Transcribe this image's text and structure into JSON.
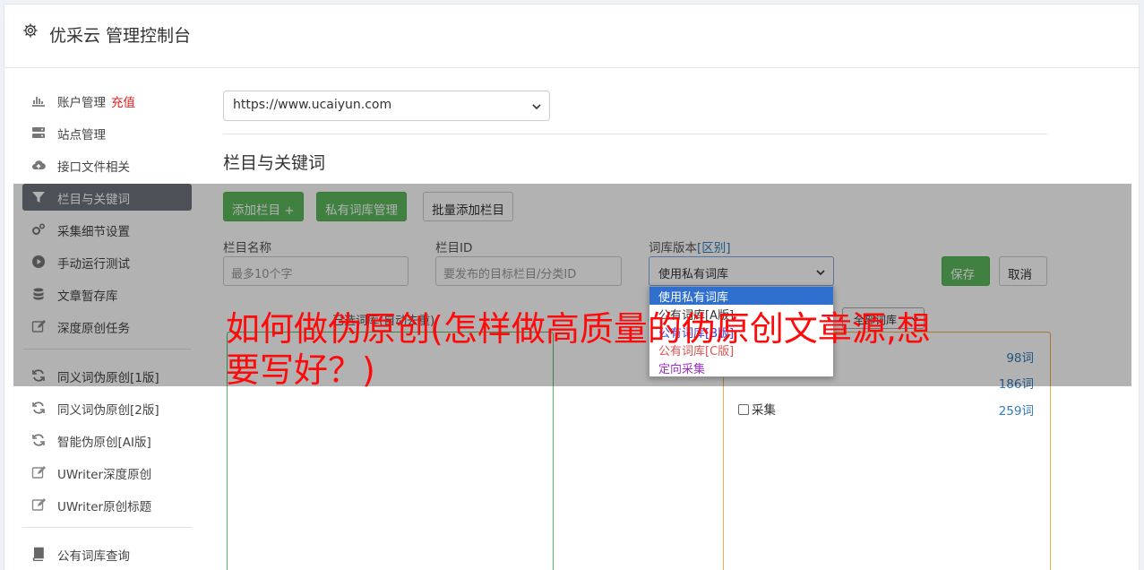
{
  "header": {
    "title": "优采云 管理控制台",
    "icon": "gear-icon"
  },
  "sidebar": {
    "items": [
      {
        "label": "账户管理",
        "extra": "充值",
        "icon": "bar-chart-icon"
      },
      {
        "label": "站点管理",
        "icon": "server-icon"
      },
      {
        "label": "接口文件相关",
        "icon": "cloud-upload-icon"
      },
      {
        "label": "栏目与关键词",
        "icon": "filter-icon",
        "active": true
      },
      {
        "label": "采集细节设置",
        "icon": "cogs-icon"
      },
      {
        "label": "手动运行测试",
        "icon": "play-circle-icon"
      },
      {
        "label": "文章暂存库",
        "icon": "database-icon"
      },
      {
        "label": "深度原创任务",
        "icon": "edit-icon"
      },
      {
        "label": "同义词伪原创[1版]",
        "icon": "refresh-icon"
      },
      {
        "label": "同义词伪原创[2版]",
        "icon": "refresh-icon"
      },
      {
        "label": "智能伪原创[AI版]",
        "icon": "refresh-icon"
      },
      {
        "label": "UWriter深度原创",
        "icon": "edit-icon"
      },
      {
        "label": "UWriter原创标题",
        "icon": "edit-icon"
      },
      {
        "label": "公有词库查询",
        "icon": "book-icon"
      }
    ]
  },
  "site_select": {
    "value": "https://www.ucaiyun.com"
  },
  "section_title": "栏目与关键词",
  "toolbar": {
    "add_column": "添加栏目 +",
    "private_lib": "私有词库管理",
    "batch_add": "批量添加栏目"
  },
  "form": {
    "name_label": "栏目名称",
    "name_placeholder": "最多10个字",
    "id_label": "栏目ID",
    "id_placeholder": "要发布的目标栏目/分类ID",
    "version_label": "词库版本",
    "version_link": "[区别]",
    "version_value": "使用私有词库",
    "save": "保存",
    "cancel": "取消"
  },
  "dropdown": {
    "options": [
      {
        "label": "使用私有词库",
        "color": "#ffffff",
        "selected": true
      },
      {
        "label": "公有词库[A版]",
        "color": "#333333"
      },
      {
        "label": "公有词库[B版]",
        "color": "#3a3ad8"
      },
      {
        "label": "公有词库[C版]",
        "color": "#d9534f"
      },
      {
        "label": "定向采集",
        "color": "#9b30c8"
      }
    ]
  },
  "panels": {
    "left_caption": "已选词库(自动去重)",
    "filter_value": "全部词库",
    "word_counts": [
      "98词",
      "186词",
      "259词"
    ],
    "checkbox_label": "采集"
  },
  "headline": "如何做伪原创(怎样做高质量的伪原创文章源,想要写好？)",
  "colors": {
    "accent_green": "#5cb85c",
    "active_nav": "#6c757d",
    "headline_red": "#ff0a0a"
  }
}
